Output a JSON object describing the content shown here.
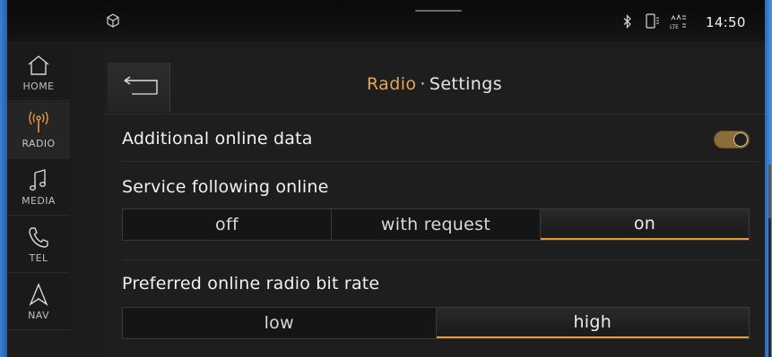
{
  "status": {
    "time": "14:50",
    "icons": [
      "settings-cube-icon",
      "bluetooth-icon",
      "phone-icon",
      "lte-signal-icon"
    ]
  },
  "sidebar": {
    "items": [
      {
        "label": "HOME",
        "icon": "home-icon",
        "active": false
      },
      {
        "label": "RADIO",
        "icon": "radio-antenna-icon",
        "active": true
      },
      {
        "label": "MEDIA",
        "icon": "music-note-icon",
        "active": false
      },
      {
        "label": "TEL",
        "icon": "phone-handset-icon",
        "active": false
      },
      {
        "label": "NAV",
        "icon": "navigation-arrow-icon",
        "active": false
      }
    ]
  },
  "header": {
    "title_primary": "Radio",
    "title_separator": "·",
    "title_secondary": "Settings",
    "back_icon": "back-arrow-icon"
  },
  "settings": {
    "additional_online_data": {
      "label": "Additional online data",
      "enabled": true
    },
    "service_following": {
      "label": "Service following online",
      "options": [
        "off",
        "with request",
        "on"
      ],
      "selected": "on"
    },
    "bit_rate": {
      "label": "Preferred online radio bit rate",
      "options": [
        "low",
        "high"
      ],
      "selected": "high"
    }
  },
  "colors": {
    "accent": "#e79a3a",
    "title_accent": "#e8a45a",
    "toggle_on": "#8a6d3b",
    "background": "#1e1e1e"
  }
}
